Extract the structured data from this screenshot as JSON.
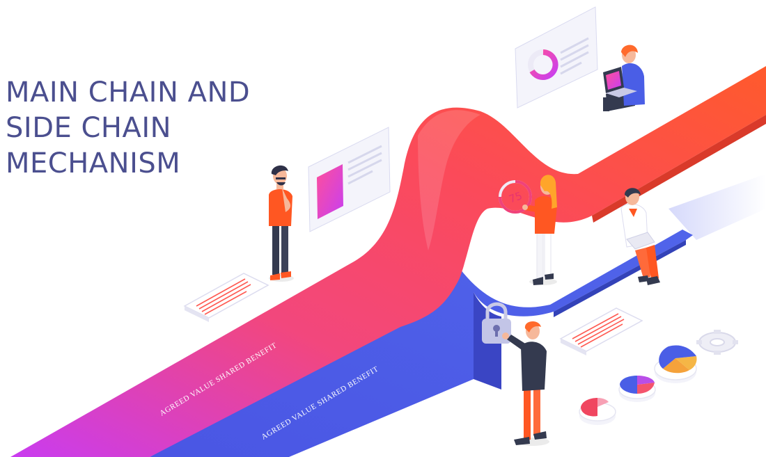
{
  "title_lines": [
    "MAIN CHAIN AND",
    "SIDE CHAIN",
    "MECHANISM"
  ],
  "main_chain_text": "AGREED VALUE  SHARED BENEFIT",
  "side_chain_text": "AGREED VALUE  SHARED BENEFIT",
  "gauge_value": "75",
  "colors": {
    "title": "#4b4f8f",
    "main_chain_start": "#d43fe8",
    "main_chain_end": "#ff5a30",
    "side_chain": "#4a5ee6",
    "accent_orange": "#ff5722",
    "dark_clothing": "#343a4f"
  },
  "icons": [
    "lock-icon",
    "gear-icon",
    "donut-chart-icon",
    "pie-chart-icon",
    "laptop-icon"
  ]
}
